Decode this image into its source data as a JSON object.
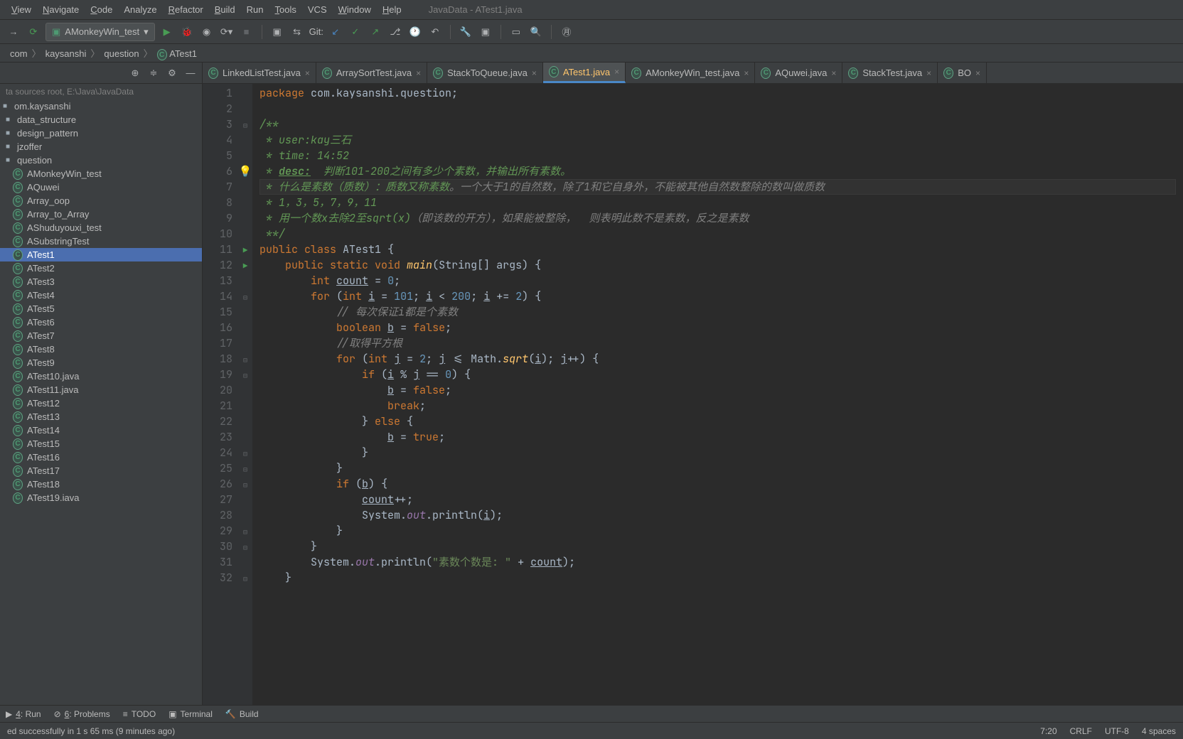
{
  "window_title": "JavaData - ATest1.java",
  "menu": [
    "View",
    "Navigate",
    "Code",
    "Analyze",
    "Refactor",
    "Build",
    "Run",
    "Tools",
    "VCS",
    "Window",
    "Help"
  ],
  "menu_underline_idx": [
    0,
    0,
    0,
    -1,
    0,
    0,
    -1,
    0,
    -1,
    0,
    0
  ],
  "run_config": "AMonkeyWin_test",
  "vcs_label": "Git:",
  "breadcrumbs": [
    "com",
    "kaysanshi",
    "question",
    "ATest1"
  ],
  "sidebar_sources": "ta  sources root,  E:\\Java\\JavaData",
  "tree_packages": [
    "om.kaysanshi",
    "data_structure",
    "design_pattern",
    "jzoffer",
    "question"
  ],
  "tree_files": [
    "AMonkeyWin_test",
    "AQuwei",
    "Array_oop",
    "Array_to_Array",
    "AShuduyouxi_test",
    "ASubstringTest",
    "ATest1",
    "ATest2",
    "ATest3",
    "ATest4",
    "ATest5",
    "ATest6",
    "ATest7",
    "ATest8",
    "ATest9",
    "ATest10.java",
    "ATest11.java",
    "ATest12",
    "ATest13",
    "ATest14",
    "ATest15",
    "ATest16",
    "ATest17",
    "ATest18",
    "ATest19.iava"
  ],
  "tree_selected": "ATest1",
  "tabs": [
    {
      "label": "LinkedListTest.java",
      "active": false
    },
    {
      "label": "ArraySortTest.java",
      "active": false
    },
    {
      "label": "StackToQueue.java",
      "active": false
    },
    {
      "label": "ATest1.java",
      "active": true
    },
    {
      "label": "AMonkeyWin_test.java",
      "active": false
    },
    {
      "label": "AQuwei.java",
      "active": false
    },
    {
      "label": "StackTest.java",
      "active": false
    },
    {
      "label": "BO",
      "active": false
    }
  ],
  "code_lines": [
    {
      "n": 1,
      "html": "<span class='kw'>package</span> com.kaysanshi.question;"
    },
    {
      "n": 2,
      "html": ""
    },
    {
      "n": 3,
      "html": "<span class='doc'>/**</span>",
      "fold": "⊟"
    },
    {
      "n": 4,
      "html": "<span class='doc'> * user:kay三石</span>"
    },
    {
      "n": 5,
      "html": "<span class='doc'> * time: 14:52</span>"
    },
    {
      "n": 6,
      "html": "<span class='doc'> * <span class='doctag'>desc:</span>  判断101-200之间有多少个素数，并输出所有素数。</span>",
      "icon": "bulb"
    },
    {
      "n": 7,
      "html": "<span class='doc'> * 什么是素数（质数）：质数又称素数</span><span class='cmt'>。一个大于1的自然数，除了1和它自身外，不能被其他自然数整除的数叫做质数</span>",
      "current": true
    },
    {
      "n": 8,
      "html": "<span class='doc'> * 1，3，5，7，9，11</span>"
    },
    {
      "n": 9,
      "html": "<span class='doc'> * 用一个数x去除2至sqrt(x)</span><span class='cmt'>（即该数的开方），如果能被整除，  则表明此数不是素数，反之是素数</span>"
    },
    {
      "n": 10,
      "html": "<span class='doc'> **/</span>"
    },
    {
      "n": 11,
      "html": "<span class='kw'>public class</span> <span class='cls'>ATest1</span> {",
      "run": true,
      "fold": "⊟"
    },
    {
      "n": 12,
      "html": "    <span class='kw'>public static void</span> <span class='fn'>main</span>(String[] args) {",
      "run": true,
      "fold": "⊟"
    },
    {
      "n": 13,
      "html": "        <span class='kw'>int</span> <u>count</u> = <span class='num'>0</span>;"
    },
    {
      "n": 14,
      "html": "        <span class='kw'>for</span> (<span class='kw'>int</span> <u>i</u> = <span class='num'>101</span>; <u>i</u> &lt; <span class='num'>200</span>; <u>i</u> += <span class='num'>2</span>) {",
      "fold": "⊟"
    },
    {
      "n": 15,
      "html": "            <span class='cmt'>// 每次保证i都是个素数</span>"
    },
    {
      "n": 16,
      "html": "            <span class='kw'>boolean</span> <u>b</u> = <span class='kw'>false</span>;"
    },
    {
      "n": 17,
      "html": "            <span class='cmt'>//取得平方根</span>"
    },
    {
      "n": 18,
      "html": "            <span class='kw'>for</span> (<span class='kw'>int</span> <u>j</u> = <span class='num'>2</span>; <u>j</u> &lt;= Math.<span class='fn'>sqrt</span>(<u>i</u>); <u>j</u>++) {",
      "fold": "⊟"
    },
    {
      "n": 19,
      "html": "                <span class='kw'>if</span> (<u>i</u> % <u>j</u> == <span class='num'>0</span>) {",
      "fold": "⊟"
    },
    {
      "n": 20,
      "html": "                    <u>b</u> = <span class='kw'>false</span>;"
    },
    {
      "n": 21,
      "html": "                    <span class='kw'>break</span>;"
    },
    {
      "n": 22,
      "html": "                } <span class='kw'>else</span> {"
    },
    {
      "n": 23,
      "html": "                    <u>b</u> = <span class='kw'>true</span>;"
    },
    {
      "n": 24,
      "html": "                }",
      "fold": "⊟"
    },
    {
      "n": 25,
      "html": "            }",
      "fold": "⊟"
    },
    {
      "n": 26,
      "html": "            <span class='kw'>if</span> (<u>b</u>) {",
      "fold": "⊟"
    },
    {
      "n": 27,
      "html": "                <u>count</u>++;"
    },
    {
      "n": 28,
      "html": "                System.<span class='fld'>out</span>.println(<u>i</u>);"
    },
    {
      "n": 29,
      "html": "            }",
      "fold": "⊟"
    },
    {
      "n": 30,
      "html": "        }",
      "fold": "⊟"
    },
    {
      "n": 31,
      "html": "        System.<span class='fld'>out</span>.println(<span class='str'>\"素数个数是: \"</span> + <u>count</u>);"
    },
    {
      "n": 32,
      "html": "    }",
      "fold": "⊟"
    }
  ],
  "bottom_tabs": [
    {
      "label": "4: Run",
      "short": "4"
    },
    {
      "label": "6: Problems",
      "short": "6"
    },
    {
      "label": "TODO"
    },
    {
      "label": "Terminal"
    },
    {
      "label": "Build"
    }
  ],
  "status_message": "ed successfully in 1 s 65 ms (9 minutes ago)",
  "status_right": {
    "pos": "7:20",
    "line_sep": "CRLF",
    "encoding": "UTF-8",
    "indent": "4 spaces"
  }
}
